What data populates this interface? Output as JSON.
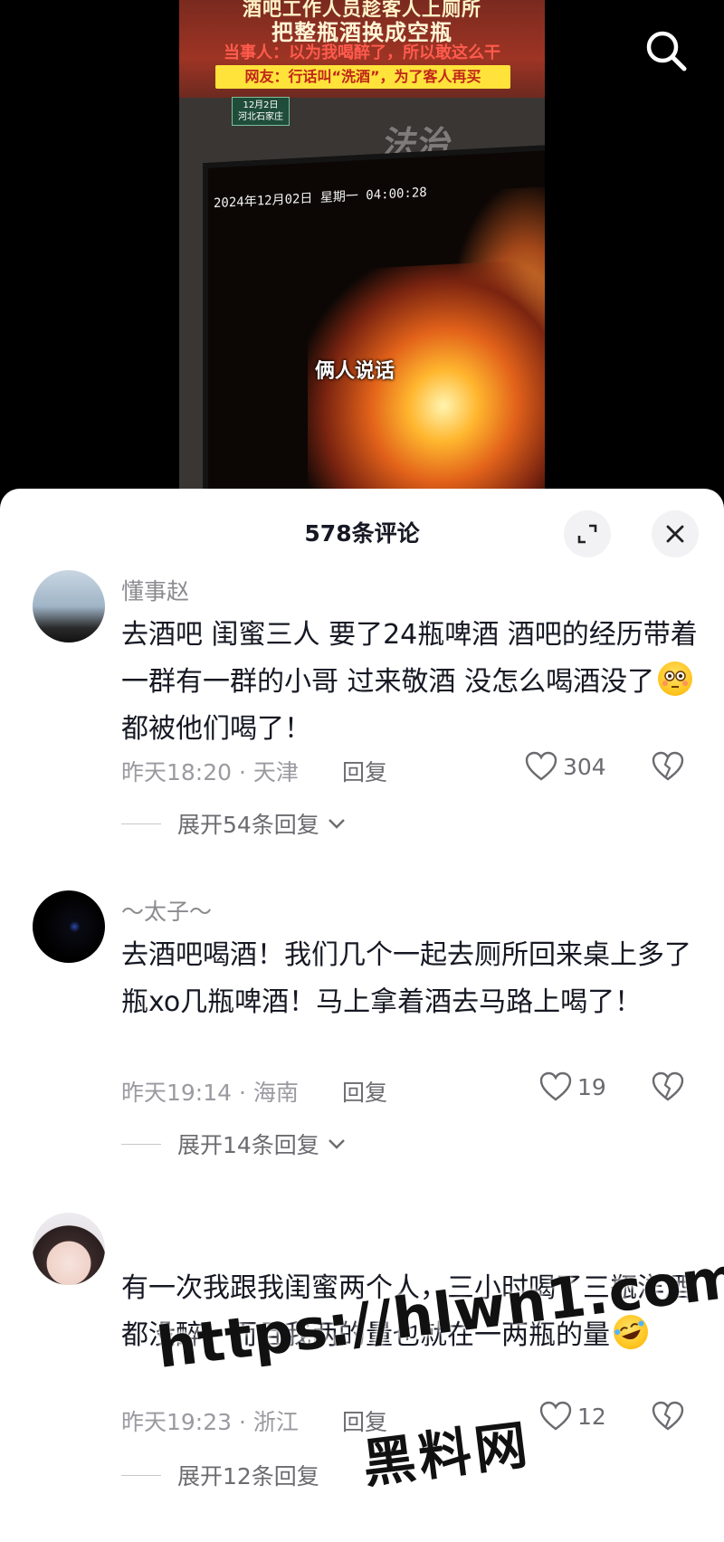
{
  "video": {
    "headline_line1": "酒吧工作人员趁客人上厕所",
    "headline_line2": "把整瓶酒换成空瓶",
    "party_quote": "当事人：以为我喝醉了，所以敢这么干",
    "netizen_quote": "网友：行话叫“洗酒”，为了客人再买",
    "date_stamp_line1": "12月2日",
    "date_stamp_line2": "河北石家庄",
    "watermark": "法治",
    "cctv_timestamp": "2024年12月02日 星期一 04:00:28",
    "caption": "俩人说话"
  },
  "sheet": {
    "title": "578条评论"
  },
  "comments": [
    {
      "username": "懂事赵",
      "text_a": "去酒吧 闺蜜三人 要了24瓶啤酒 酒吧的经历带着一群有一群的小哥 过来敬酒 没怎么喝酒没了",
      "emoji": "flushed-face-emoji",
      "text_b": " 都被他们喝了！",
      "time_location": "昨天18:20 · 天津",
      "reply_label": "回复",
      "likes": "304",
      "expand_label": "展开54条回复"
    },
    {
      "username": "～太子～",
      "text_a": "去酒吧喝酒！我们几个一起去厕所回来桌上多了瓶xo几瓶啤酒！马上拿着酒去马路上喝了！",
      "time_location": "昨天19:14 · 海南",
      "reply_label": "回复",
      "likes": "19",
      "expand_label": "展开14条回复"
    },
    {
      "username": "",
      "text_a": "有一次我跟我闺蜜两个人，三小时喝了三瓶洋酒都没醉。而且我两的量也就在一两瓶的量",
      "emoji": "rolling-laughing-emoji",
      "time_location": "昨天19:23 · 浙江",
      "reply_label": "回复",
      "likes": "12",
      "expand_label": "展开12条回复"
    }
  ],
  "watermark": {
    "url": "https://hlwn1.com",
    "name": "黑料网"
  },
  "colors": {
    "sheet_bg": "#ffffff",
    "muted_text": "#9a9aa0",
    "primary_text": "#161823"
  }
}
